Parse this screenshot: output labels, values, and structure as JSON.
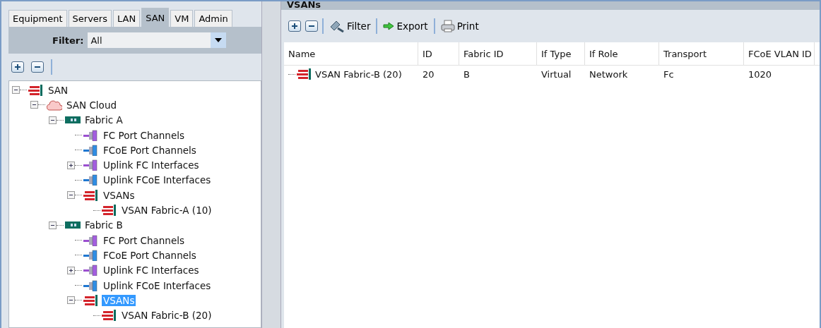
{
  "tabs": [
    {
      "label": "Equipment",
      "selected": false
    },
    {
      "label": "Servers",
      "selected": false
    },
    {
      "label": "LAN",
      "selected": false
    },
    {
      "label": "SAN",
      "selected": true
    },
    {
      "label": "VM",
      "selected": false
    },
    {
      "label": "Admin",
      "selected": false
    }
  ],
  "filter": {
    "label": "Filter:",
    "value": "All"
  },
  "tree": [
    {
      "label": "SAN",
      "kind": "vsan",
      "expanded": true,
      "selected": false,
      "children": [
        {
          "label": "SAN Cloud",
          "kind": "cloud",
          "expanded": true,
          "selected": false,
          "children": [
            {
              "label": "Fabric A",
              "kind": "fabric",
              "expanded": true,
              "selected": false,
              "children": [
                {
                  "label": "FC Port Channels",
                  "kind": "fc",
                  "selected": false
                },
                {
                  "label": "FCoE Port Channels",
                  "kind": "fcoe",
                  "selected": false
                },
                {
                  "label": "Uplink FC Interfaces",
                  "kind": "fc",
                  "expanded": false,
                  "selected": false
                },
                {
                  "label": "Uplink FCoE Interfaces",
                  "kind": "fcoe",
                  "selected": false
                },
                {
                  "label": "VSANs",
                  "kind": "vsan",
                  "expanded": true,
                  "selected": false,
                  "children": [
                    {
                      "label": "VSAN Fabric-A (10)",
                      "kind": "vsan",
                      "selected": false
                    }
                  ]
                }
              ]
            },
            {
              "label": "Fabric B",
              "kind": "fabric",
              "expanded": true,
              "selected": false,
              "children": [
                {
                  "label": "FC Port Channels",
                  "kind": "fc",
                  "selected": false
                },
                {
                  "label": "FCoE Port Channels",
                  "kind": "fcoe",
                  "selected": false
                },
                {
                  "label": "Uplink FC Interfaces",
                  "kind": "fc",
                  "expanded": false,
                  "selected": false
                },
                {
                  "label": "Uplink FCoE Interfaces",
                  "kind": "fcoe",
                  "selected": false
                },
                {
                  "label": "VSANs",
                  "kind": "vsan",
                  "expanded": true,
                  "selected": true,
                  "children": [
                    {
                      "label": "VSAN Fabric-B (20)",
                      "kind": "vsan",
                      "selected": false
                    }
                  ]
                }
              ]
            }
          ]
        }
      ]
    }
  ],
  "panel": {
    "title": "VSANs",
    "toolbar": [
      {
        "kind": "add"
      },
      {
        "kind": "remove"
      },
      {
        "kind": "filter",
        "label": "Filter"
      },
      {
        "kind": "export",
        "label": "Export"
      },
      {
        "kind": "print",
        "label": "Print"
      }
    ],
    "table": {
      "columns": [
        "Name",
        "ID",
        "Fabric ID",
        "If Type",
        "If Role",
        "Transport",
        "FCoE VLAN ID"
      ],
      "rows": [
        [
          "VSAN Fabric-B (20)",
          "20",
          "B",
          "Virtual",
          "Network",
          "Fc",
          "1020"
        ]
      ]
    }
  }
}
